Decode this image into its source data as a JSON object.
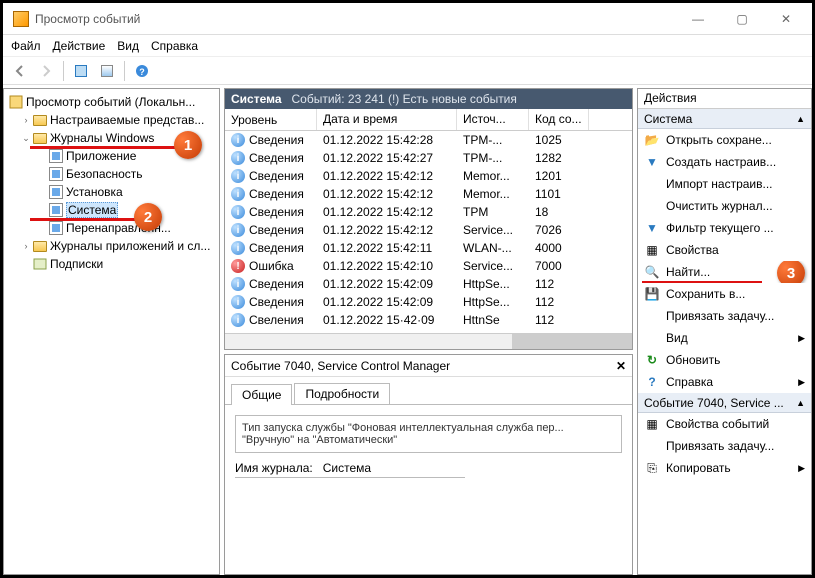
{
  "title": "Просмотр событий",
  "menu": [
    "Файл",
    "Действие",
    "Вид",
    "Справка"
  ],
  "tree": {
    "root": "Просмотр событий (Локальн...",
    "custom_views": "Настраиваемые представ...",
    "win_logs": "Журналы Windows",
    "app": "Приложение",
    "security": "Безопасность",
    "setup": "Установка",
    "system": "Система",
    "forwarded": "Перенаправленн...",
    "app_services": "Журналы приложений и сл...",
    "subs": "Подписки"
  },
  "grid": {
    "header_title": "Система",
    "header_sub": "Событий: 23 241 (!) Есть новые события",
    "cols": [
      "Уровень",
      "Дата и время",
      "Источ...",
      "Код со..."
    ],
    "rows": [
      {
        "lvl": "Сведения",
        "t": "01.12.2022 15:42:28",
        "s": "TPM-...",
        "c": "1025",
        "e": false
      },
      {
        "lvl": "Сведения",
        "t": "01.12.2022 15:42:27",
        "s": "TPM-...",
        "c": "1282",
        "e": false
      },
      {
        "lvl": "Сведения",
        "t": "01.12.2022 15:42:12",
        "s": "Memor...",
        "c": "1201",
        "e": false
      },
      {
        "lvl": "Сведения",
        "t": "01.12.2022 15:42:12",
        "s": "Memor...",
        "c": "1101",
        "e": false
      },
      {
        "lvl": "Сведения",
        "t": "01.12.2022 15:42:12",
        "s": "TPM",
        "c": "18",
        "e": false
      },
      {
        "lvl": "Сведения",
        "t": "01.12.2022 15:42:12",
        "s": "Service...",
        "c": "7026",
        "e": false
      },
      {
        "lvl": "Сведения",
        "t": "01.12.2022 15:42:11",
        "s": "WLAN-...",
        "c": "4000",
        "e": false
      },
      {
        "lvl": "Ошибка",
        "t": "01.12.2022 15:42:10",
        "s": "Service...",
        "c": "7000",
        "e": true
      },
      {
        "lvl": "Сведения",
        "t": "01.12.2022 15:42:09",
        "s": "HttpSe...",
        "c": "112",
        "e": false
      },
      {
        "lvl": "Сведения",
        "t": "01.12.2022 15:42:09",
        "s": "HttpSe...",
        "c": "112",
        "e": false
      },
      {
        "lvl": "Свеления",
        "t": "01.12.2022 15·42·09",
        "s": "HttnSe",
        "c": "112",
        "e": false
      }
    ]
  },
  "detail": {
    "title": "Событие 7040, Service Control Manager",
    "tab1": "Общие",
    "tab2": "Подробности",
    "msg": "Тип запуска службы \"Фоновая интеллектуальная служба пер... \"Вручную\" на \"Автоматически\"",
    "log_label": "Имя журнала:",
    "log_value": "Система"
  },
  "actions": {
    "title": "Действия",
    "sec1": "Система",
    "items1": [
      {
        "icon": "📂",
        "t": "Открыть сохране..."
      },
      {
        "icon": "▼",
        "t": "Создать настраив...",
        "filter": true
      },
      {
        "icon": "",
        "t": "Импорт настраив..."
      },
      {
        "icon": "",
        "t": "Очистить журнал..."
      },
      {
        "icon": "▼",
        "t": "Фильтр текущего ...",
        "filter": true
      },
      {
        "icon": "▦",
        "t": "Свойства"
      },
      {
        "icon": "🔍",
        "t": "Найти..."
      },
      {
        "icon": "💾",
        "t": "Сохранить в..."
      },
      {
        "icon": "",
        "t": "Привязать задачу..."
      },
      {
        "icon": "",
        "t": "Вид",
        "arrow": true
      },
      {
        "icon": "↻",
        "t": "Обновить",
        "green": true
      },
      {
        "icon": "?",
        "t": "Справка",
        "arrow": true,
        "blue": true
      }
    ],
    "sec2": "Событие 7040, Service ...",
    "items2": [
      {
        "icon": "▦",
        "t": "Свойства событий"
      },
      {
        "icon": "",
        "t": "Привязать задачу..."
      },
      {
        "icon": "⎘",
        "t": "Копировать",
        "arrow": true
      }
    ]
  },
  "callouts": {
    "1": "1",
    "2": "2",
    "3": "3"
  }
}
